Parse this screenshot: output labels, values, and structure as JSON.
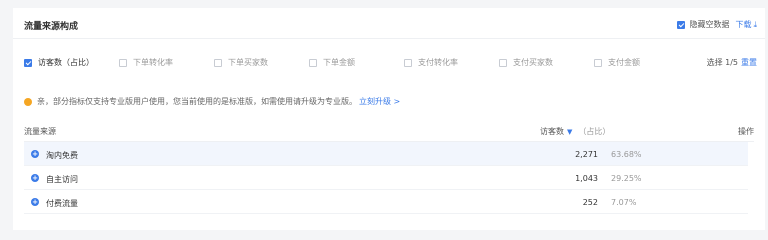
{
  "header": {
    "title": "流量来源构成",
    "hide_empty_label": "隐藏空数据",
    "download_label": "下载",
    "download_icon": "download-arrow-icon"
  },
  "metrics": {
    "items": [
      {
        "label": "访客数（占比）",
        "checked": true
      },
      {
        "label": "下单转化率",
        "checked": false
      },
      {
        "label": "下单买家数",
        "checked": false
      },
      {
        "label": "下单金额",
        "checked": false
      },
      {
        "label": "支付转化率",
        "checked": false
      },
      {
        "label": "支付买家数",
        "checked": false
      },
      {
        "label": "支付金额",
        "checked": false
      }
    ],
    "selected_text": "选择 1/5",
    "reset_label": "重置"
  },
  "notice": {
    "text": "亲，部分指标仅支持专业版用户使用，您当前使用的是标准版，如需使用请升级为专业版。",
    "upgrade_label": "立刻升级 >"
  },
  "table": {
    "col_source": "流量来源",
    "col_visitors": "访客数",
    "col_share": "（占比）",
    "col_actions": "操作",
    "rows": [
      {
        "name": "淘内免费",
        "visitors": "2,271",
        "share": "63.68%"
      },
      {
        "name": "自主访问",
        "visitors": "1,043",
        "share": "29.25%"
      },
      {
        "name": "付费流量",
        "visitors": "252",
        "share": "7.07%"
      }
    ]
  },
  "colors": {
    "accent": "#3b7be8",
    "warning": "#f5a623",
    "row_highlight": "#f2f6fd"
  }
}
